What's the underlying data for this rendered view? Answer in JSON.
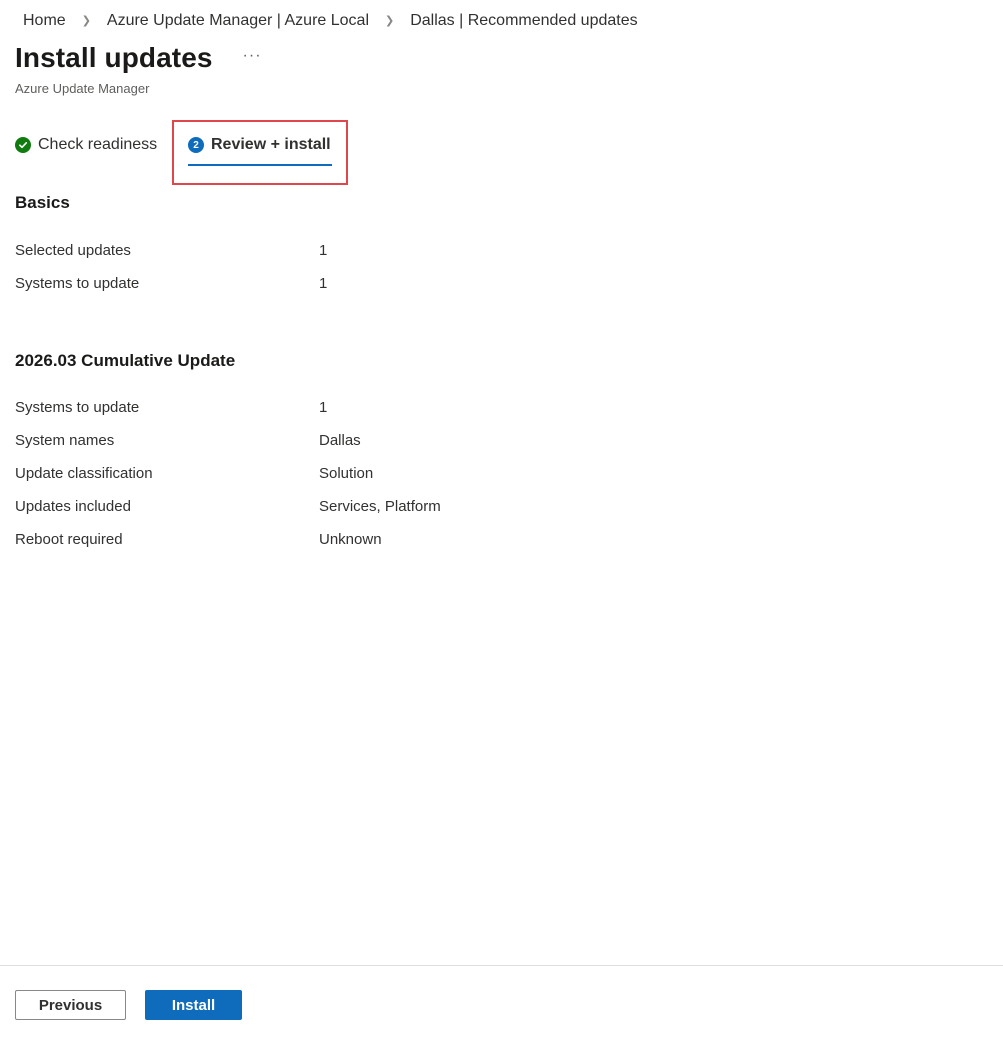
{
  "breadcrumb": {
    "items": [
      "Home",
      "Azure Update Manager | Azure Local",
      "Dallas | Recommended updates"
    ]
  },
  "header": {
    "title": "Install updates",
    "more": "···",
    "subtitle": "Azure Update Manager"
  },
  "tabs": [
    {
      "label": "Check readiness",
      "status": "complete",
      "icon": "check-circle-icon"
    },
    {
      "label": "Review + install",
      "step": "2",
      "active": true
    }
  ],
  "basics": {
    "title": "Basics",
    "rows": [
      {
        "label": "Selected updates",
        "value": "1"
      },
      {
        "label": "Systems to update",
        "value": "1"
      }
    ]
  },
  "update": {
    "title": "2026.03 Cumulative Update",
    "rows": [
      {
        "label": "Systems to update",
        "value": "1"
      },
      {
        "label": "System names",
        "value": "Dallas"
      },
      {
        "label": "Update classification",
        "value": "Solution"
      },
      {
        "label": "Updates included",
        "value": "Services, Platform"
      },
      {
        "label": "Reboot required",
        "value": "Unknown"
      }
    ]
  },
  "footer": {
    "previous_label": "Previous",
    "install_label": "Install"
  },
  "colors": {
    "accent": "#0f6cbd",
    "success": "#107c10",
    "highlight": "#e0474c"
  }
}
